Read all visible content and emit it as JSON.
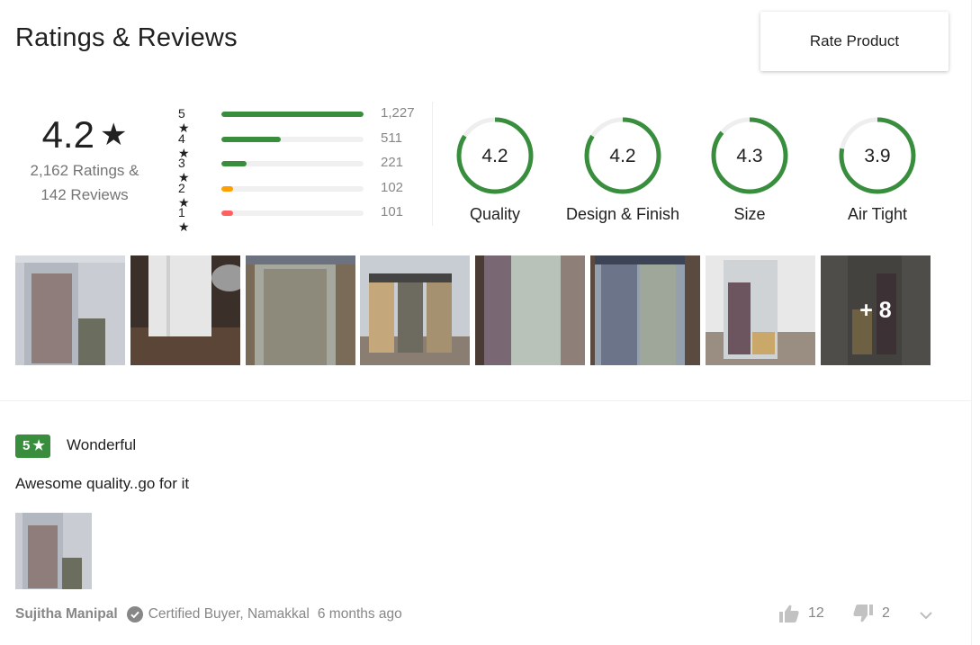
{
  "page_title": "Ratings & Reviews",
  "rate_button": "Rate Product",
  "overall": {
    "rating": "4.2",
    "star": "★",
    "ratings_text": "2,162 Ratings &",
    "reviews_text": "142 Reviews"
  },
  "distribution": [
    {
      "label": "5 ★",
      "count": "1,227",
      "fraction": 1.0,
      "color": "#388e3c"
    },
    {
      "label": "4 ★",
      "count": "511",
      "fraction": 0.416,
      "color": "#388e3c"
    },
    {
      "label": "3 ★",
      "count": "221",
      "fraction": 0.18,
      "color": "#388e3c"
    },
    {
      "label": "2 ★",
      "count": "102",
      "fraction": 0.083,
      "color": "#ff9f00"
    },
    {
      "label": "1 ★",
      "count": "101",
      "fraction": 0.082,
      "color": "#ff6161"
    }
  ],
  "aspects": [
    {
      "value": "4.2",
      "label": "Quality",
      "fraction": 0.84
    },
    {
      "value": "4.2",
      "label": "Design & Finish",
      "fraction": 0.84
    },
    {
      "value": "4.3",
      "label": "Size",
      "fraction": 0.86
    },
    {
      "value": "3.9",
      "label": "Air Tight",
      "fraction": 0.78
    }
  ],
  "accent_color": "#388e3c",
  "more_photos": "+ 8",
  "review": {
    "rating": "5",
    "star": "★",
    "title": "Wonderful",
    "text": "Awesome quality..go for it",
    "author": "Sujitha Manipal",
    "certified": "Certified Buyer, Namakkal",
    "date": "6 months ago",
    "likes": "12",
    "dislikes": "2"
  }
}
